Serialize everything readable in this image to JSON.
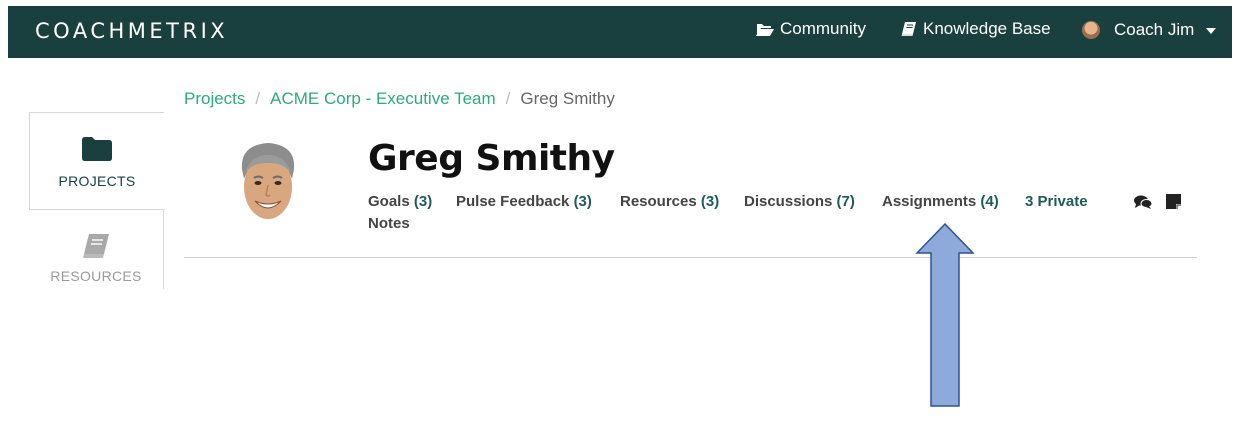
{
  "navbar": {
    "brand": "COACHMETRIX",
    "community_label": "Community",
    "knowledge_base_label": "Knowledge Base",
    "user_label": "Coach Jim",
    "icons": [
      "folder-open-icon",
      "book-icon",
      "avatar",
      "caret-down-icon"
    ]
  },
  "sidebar": {
    "items": [
      {
        "label": "PROJECTS",
        "icon": "folder-icon",
        "active": true
      },
      {
        "label": "RESOURCES",
        "icon": "book-icon",
        "active": false
      }
    ]
  },
  "breadcrumb": {
    "items": [
      "Projects",
      "ACME Corp - Executive Team",
      "Greg Smithy"
    ],
    "separator": "/"
  },
  "profile": {
    "name": "Greg Smithy",
    "tabs": [
      {
        "label": "Goals",
        "count": "(3)"
      },
      {
        "label": "Pulse Feedback",
        "count": "(3)"
      },
      {
        "label": "Resources",
        "count": "(3)"
      },
      {
        "label": "Discussions",
        "count": "(7)"
      },
      {
        "label": "Assignments",
        "count": "(4)"
      }
    ],
    "private_notes": {
      "count_text": "3 Private",
      "label": "Notes"
    },
    "action_icons": [
      "comments-icon",
      "sticky-note-icon"
    ]
  },
  "colors": {
    "navbar_bg": "#19403f",
    "link_green": "#2eaa7e",
    "count_teal": "#1f5b5a",
    "arrow_fill": "#8eaadb",
    "arrow_stroke": "#2f528f"
  }
}
